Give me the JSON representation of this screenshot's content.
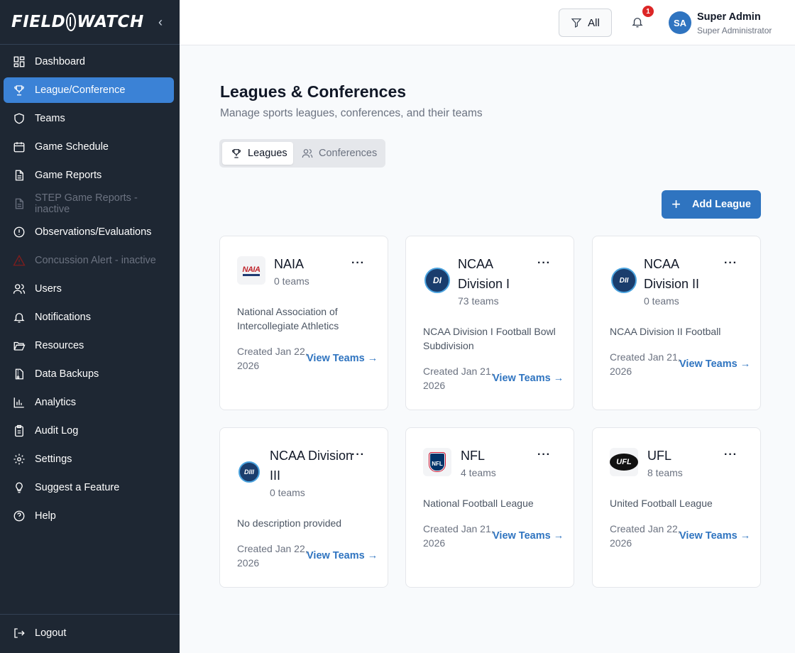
{
  "app": {
    "logo_left": "FIELD",
    "logo_right": "WATCH"
  },
  "sidebar": {
    "items": [
      {
        "label": "Dashboard",
        "icon": "dashboard-grid-icon",
        "state": "normal"
      },
      {
        "label": "League/Conference",
        "icon": "trophy-icon",
        "state": "active"
      },
      {
        "label": "Teams",
        "icon": "shield-icon",
        "state": "normal"
      },
      {
        "label": "Game Schedule",
        "icon": "calendar-icon",
        "state": "normal"
      },
      {
        "label": "Game Reports",
        "icon": "document-icon",
        "state": "normal"
      },
      {
        "label": "STEP Game Reports - inactive",
        "icon": "document-icon",
        "state": "inactive"
      },
      {
        "label": "Observations/Evaluations",
        "icon": "alert-circle-icon",
        "state": "normal"
      },
      {
        "label": "Concussion Alert - inactive",
        "icon": "warning-triangle-icon",
        "state": "inactive"
      },
      {
        "label": "Users",
        "icon": "users-icon",
        "state": "normal"
      },
      {
        "label": "Notifications",
        "icon": "bell-icon",
        "state": "normal"
      },
      {
        "label": "Resources",
        "icon": "folder-open-icon",
        "state": "normal"
      },
      {
        "label": "Data Backups",
        "icon": "file-archive-icon",
        "state": "normal"
      },
      {
        "label": "Analytics",
        "icon": "bar-chart-icon",
        "state": "normal"
      },
      {
        "label": "Audit Log",
        "icon": "clipboard-icon",
        "state": "normal"
      },
      {
        "label": "Settings",
        "icon": "gear-icon",
        "state": "normal"
      },
      {
        "label": "Suggest a Feature",
        "icon": "lightbulb-icon",
        "state": "normal"
      },
      {
        "label": "Help",
        "icon": "help-circle-icon",
        "state": "normal"
      }
    ],
    "logout": "Logout"
  },
  "header": {
    "filter_label": "All",
    "notification_count": "1",
    "user": {
      "initials": "SA",
      "name": "Super Admin",
      "role": "Super Administrator"
    }
  },
  "main": {
    "title": "Leagues & Conferences",
    "subtitle": "Manage sports leagues, conferences, and their teams",
    "tabs": [
      {
        "label": "Leagues",
        "active": true
      },
      {
        "label": "Conferences",
        "active": false
      }
    ],
    "add_button": "Add League",
    "cards": [
      {
        "name": "NAIA",
        "teams": "0 teams",
        "description": "National Association of Intercollegiate Athletics",
        "created": "Created Jan 22, 2026",
        "view": "View Teams →",
        "logo_text": "NAIA"
      },
      {
        "name": "NCAA Division I",
        "teams": "73 teams",
        "description": "NCAA Division I Football Bowl Subdivision",
        "created": "Created Jan 21, 2026",
        "view": "View Teams →",
        "logo_text": "DI"
      },
      {
        "name": "NCAA Division II",
        "teams": "0 teams",
        "description": "NCAA Division II Football",
        "created": "Created Jan 21, 2026",
        "view": "View Teams →",
        "logo_text": "DII"
      },
      {
        "name": "NCAA Division III",
        "teams": "0 teams",
        "description": "No description provided",
        "created": "Created Jan 22, 2026",
        "view": "View Teams →",
        "logo_text": "DIII"
      },
      {
        "name": "NFL",
        "teams": "4 teams",
        "description": "National Football League",
        "created": "Created Jan 21, 2026",
        "view": "View Teams →",
        "logo_text": "NFL"
      },
      {
        "name": "UFL",
        "teams": "8 teams",
        "description": "United Football League",
        "created": "Created Jan 22, 2026",
        "view": "View Teams →",
        "logo_text": "UFL"
      }
    ],
    "card_menu": "···"
  },
  "colors": {
    "sidebar_bg": "#1e2733",
    "accent": "#2f74c0",
    "active_nav": "#3b82d6",
    "badge": "#dc2626"
  }
}
